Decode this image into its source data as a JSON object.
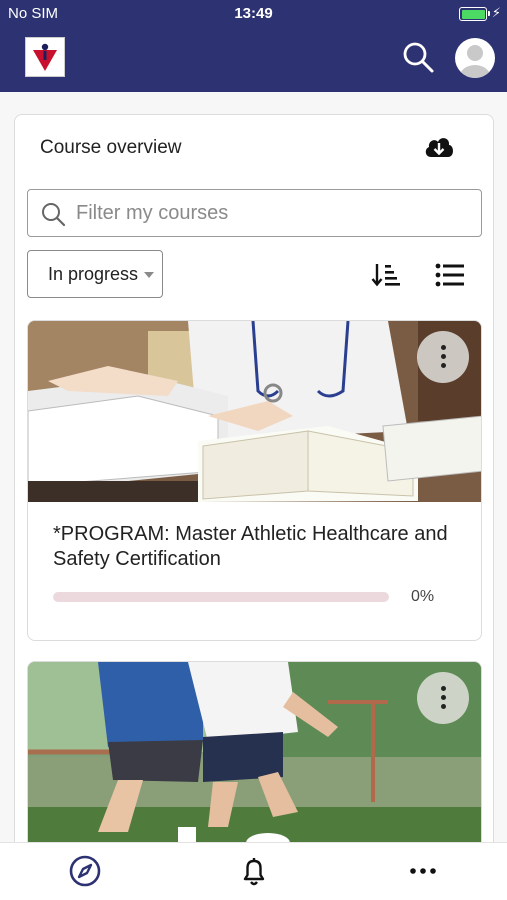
{
  "status_bar": {
    "carrier": "No SIM",
    "time": "13:49",
    "battery_color": "#4cd964"
  },
  "header": {
    "background": "#2d3272",
    "logo_icon": "brand-logo-icon",
    "search_icon": "search-icon",
    "avatar_icon": "user-avatar-icon"
  },
  "course_overview": {
    "title": "Course overview",
    "download_icon": "cloud-download-icon",
    "filter": {
      "placeholder": "Filter my courses",
      "value": ""
    },
    "status_select": {
      "selected": "In progress"
    },
    "sort_icon": "sort-icon",
    "view_icon": "list-view-icon",
    "courses": [
      {
        "title": "*PROGRAM: Master Athletic Healthcare and Safety Certification",
        "progress_label": "0%",
        "progress": 0,
        "image": "books-and-doctor-photo",
        "menu_icon": "more-vertical-icon"
      },
      {
        "title": "",
        "image": "soccer-players-photo",
        "menu_icon": "more-vertical-icon"
      }
    ]
  },
  "bottom_nav": {
    "items": [
      {
        "icon": "compass-icon",
        "active": true
      },
      {
        "icon": "bell-icon",
        "active": false
      },
      {
        "icon": "more-horizontal-icon",
        "active": false
      }
    ],
    "accent": "#2d3272"
  }
}
